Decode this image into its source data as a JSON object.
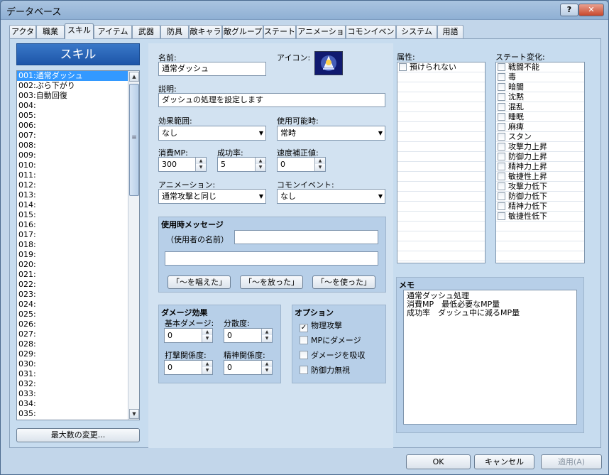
{
  "window": {
    "title": "データベース",
    "help_btn": "?",
    "close_btn": "✕"
  },
  "tabs": [
    "アクター",
    "職業",
    "スキル",
    "アイテム",
    "武器",
    "防具",
    "敵キャラ",
    "敵グループ",
    "ステート",
    "アニメーション",
    "コモンイベント",
    "システム",
    "用語"
  ],
  "sidebar": {
    "header": "スキル",
    "items": [
      "001:通常ダッシュ",
      "002:ぶら下がり",
      "003:自動回復",
      "004:",
      "005:",
      "006:",
      "007:",
      "008:",
      "009:",
      "010:",
      "011:",
      "012:",
      "013:",
      "014:",
      "015:",
      "016:",
      "017:",
      "018:",
      "019:",
      "020:",
      "021:",
      "022:",
      "023:",
      "024:",
      "025:",
      "026:",
      "027:",
      "028:",
      "029:",
      "030:",
      "031:",
      "032:",
      "033:",
      "034:",
      "035:"
    ],
    "max_button": "最大数の変更..."
  },
  "form": {
    "name_label": "名前:",
    "name_value": "通常ダッシュ",
    "icon_label": "アイコン:",
    "desc_label": "説明:",
    "desc_value": "ダッシュの処理を設定します",
    "scope_label": "効果範囲:",
    "scope_value": "なし",
    "occasion_label": "使用可能時:",
    "occasion_value": "常時",
    "mp_label": "消費MP:",
    "mp_value": "300",
    "hit_label": "成功率:",
    "hit_value": "5",
    "speed_label": "速度補正値:",
    "speed_value": "0",
    "anim_label": "アニメーション:",
    "anim_value": "通常攻撃と同じ",
    "common_label": "コモンイベント:",
    "common_value": "なし"
  },
  "message": {
    "title": "使用時メッセージ",
    "user_label": "（使用者の名前）",
    "btn1": "「～を唱えた」",
    "btn2": "「～を放った」",
    "btn3": "「～を使った」"
  },
  "damage": {
    "title": "ダメージ効果",
    "base_label": "基本ダメージ:",
    "base_value": "0",
    "var_label": "分散度:",
    "var_value": "0",
    "atk_label": "打撃関係度:",
    "atk_value": "0",
    "spi_label": "精神関係度:",
    "spi_value": "0"
  },
  "options": {
    "title": "オプション",
    "items": [
      {
        "label": "物理攻撃",
        "checked": true
      },
      {
        "label": "MPにダメージ",
        "checked": false
      },
      {
        "label": "ダメージを吸収",
        "checked": false
      },
      {
        "label": "防御力無視",
        "checked": false
      }
    ]
  },
  "attributes": {
    "label": "属性:",
    "items": [
      "預けられない"
    ]
  },
  "states": {
    "label": "ステート変化:",
    "items": [
      "戦闘不能",
      "毒",
      "暗闇",
      "沈黙",
      "混乱",
      "睡眠",
      "麻痺",
      "スタン",
      "攻撃力上昇",
      "防御力上昇",
      "精神力上昇",
      "敏捷性上昇",
      "攻撃力低下",
      "防御力低下",
      "精神力低下",
      "敏捷性低下"
    ]
  },
  "memo": {
    "label": "メモ",
    "text": "通常ダッシュ処理\n消費MP　最低必要なMP量\n成功率　ダッシュ中に減るMP量"
  },
  "footer": {
    "ok": "OK",
    "cancel": "キャンセル",
    "apply": "適用(A)"
  }
}
